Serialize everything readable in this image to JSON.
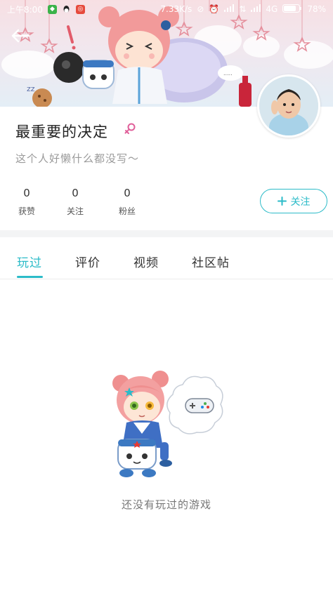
{
  "status_bar": {
    "time": "上午8:00",
    "speed": "7.33K/s",
    "network": "4G",
    "battery": "78%"
  },
  "profile": {
    "username": "最重要的决定",
    "bio": "这个人好懒什么都没写～",
    "stats": [
      {
        "value": "0",
        "label": "获赞"
      },
      {
        "value": "0",
        "label": "关注"
      },
      {
        "value": "0",
        "label": "粉丝"
      }
    ],
    "follow_label": "关注"
  },
  "tabs": [
    {
      "label": "玩过",
      "active": true
    },
    {
      "label": "评价",
      "active": false
    },
    {
      "label": "视频",
      "active": false
    },
    {
      "label": "社区帖",
      "active": false
    }
  ],
  "empty_state": {
    "message": "还没有玩过的游戏"
  },
  "colors": {
    "accent": "#2bbbc8",
    "gender": "#e0609a"
  }
}
